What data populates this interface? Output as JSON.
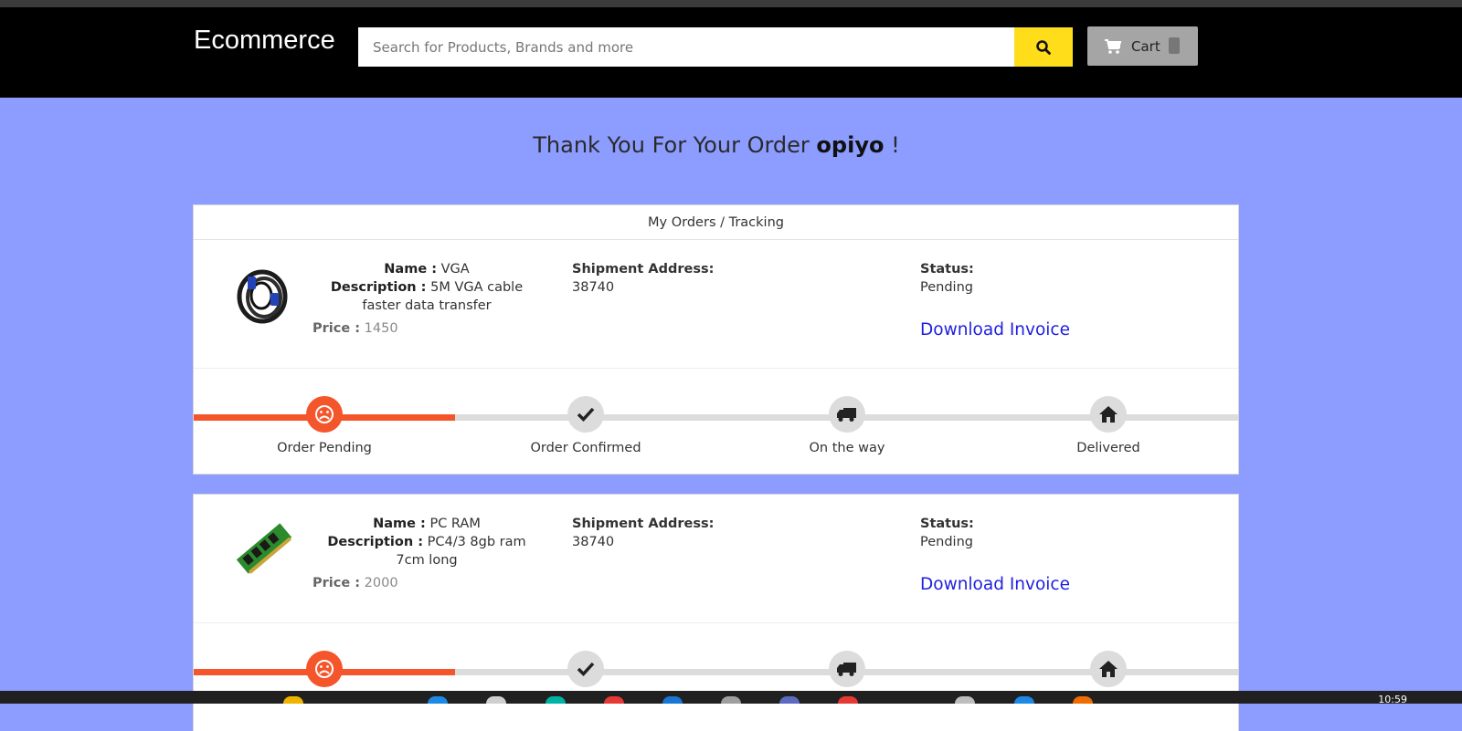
{
  "header": {
    "brand": "Ecommerce",
    "search_placeholder": "Search for Products, Brands and more",
    "search_icon": "search-icon",
    "cart_label": "Cart",
    "cart_icon": "cart-icon"
  },
  "thanks": {
    "prefix": "Thank You For Your Order",
    "username": "opiyo",
    "suffix": "!"
  },
  "orders_heading": "My Orders / Tracking",
  "labels": {
    "name": "Name :",
    "description": "Description :",
    "price": "Price :",
    "shipment": "Shipment Address:",
    "status": "Status:",
    "invoice": "Download Invoice"
  },
  "orders": [
    {
      "name": "VGA",
      "description": "5M VGA cable faster data transfer",
      "price": "1450",
      "address": "38740",
      "status": "Pending",
      "image": "vga-cable-image",
      "progress_fraction": 0.25
    },
    {
      "name": "PC RAM",
      "description": "PC4/3 8gb ram 7cm long",
      "price": "2000",
      "address": "38740",
      "status": "Pending",
      "image": "ram-module-image",
      "progress_fraction": 0.25
    }
  ],
  "tracking_steps": [
    {
      "label": "Order Pending",
      "icon": "sad-face-icon",
      "active": true
    },
    {
      "label": "Order Confirmed",
      "icon": "check-icon",
      "active": false
    },
    {
      "label": "On the way",
      "icon": "truck-icon",
      "active": false
    },
    {
      "label": "Delivered",
      "icon": "home-icon",
      "active": false
    }
  ],
  "colors": {
    "page_bg": "#8c9cff",
    "header_bg": "#000000",
    "search_button": "#ffdd1a",
    "progress_active": "#f4552b",
    "progress_inactive": "#dcdcdc",
    "invoice_link": "#1e1ee0"
  },
  "taskbar": {
    "clock": "10:59"
  }
}
